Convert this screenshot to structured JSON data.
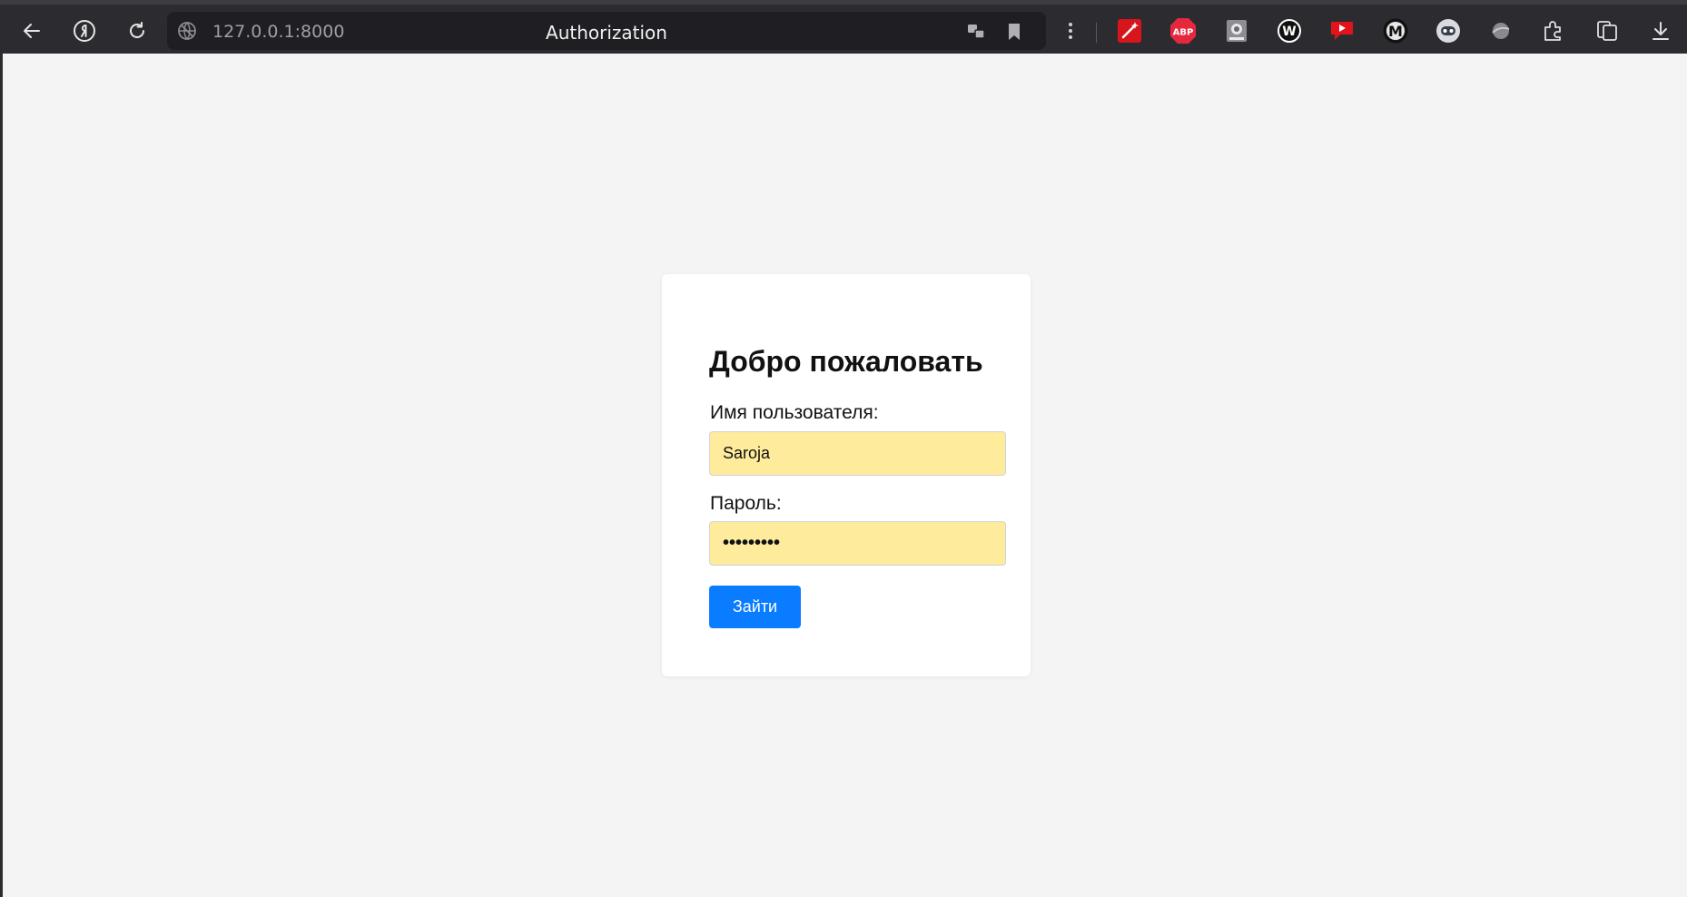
{
  "browser": {
    "url": "127.0.0.1:8000",
    "page_title": "Authorization",
    "extensions": [
      "magic-wand-icon",
      "adblock-plus-icon",
      "camera-extension-icon",
      "w-extension-icon",
      "video-extension-icon",
      "m-extension-icon",
      "bot-extension-icon",
      "sphere-extension-icon",
      "puzzle-icon",
      "collections-icon",
      "download-icon"
    ],
    "abp_text": "ABP",
    "w_text": "W",
    "m_text": "M"
  },
  "login": {
    "heading": "Добро пожаловать",
    "username_label": "Имя пользователя:",
    "username_value": "Saroja",
    "password_label": "Пароль:",
    "password_value": "•••••••••",
    "submit_label": "Зайти"
  },
  "colors": {
    "toolbar": "#2c2c30",
    "page_bg": "#f4f4f4",
    "input_autofill": "#feeb9c",
    "button": "#0a7cff"
  }
}
